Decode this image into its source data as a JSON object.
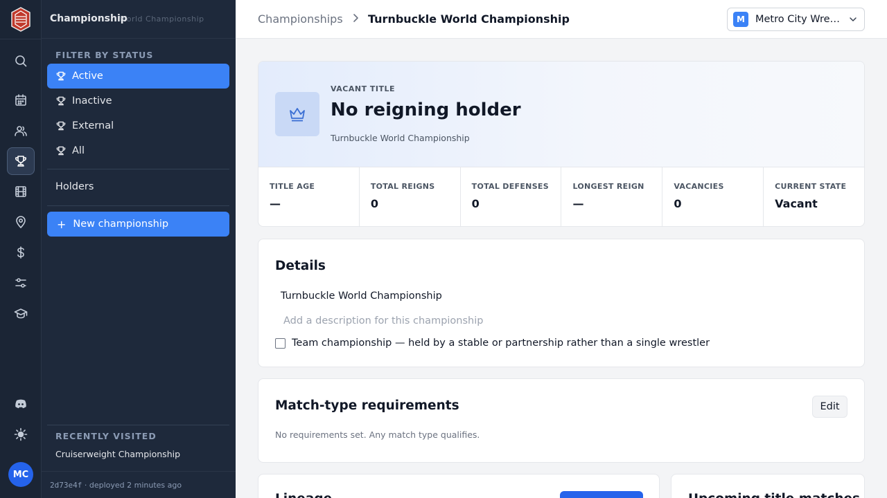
{
  "sidebar": {
    "title": "Championship",
    "title_ghost": "World Championship",
    "filter_label": "FILTER BY STATUS",
    "filters": [
      {
        "label": "Active",
        "active": true
      },
      {
        "label": "Inactive",
        "active": false
      },
      {
        "label": "External",
        "active": false
      },
      {
        "label": "All",
        "active": false
      }
    ],
    "holders_label": "Holders",
    "new_button": "New championship",
    "recent_label": "RECENTLY VISITED",
    "recent_items": [
      "Cruiserweight Championship"
    ],
    "footer_hash": "2d73e4f",
    "footer_deploy": " · deployed 2 minutes ago"
  },
  "rail": {
    "avatar_initials": "MC",
    "icons": [
      "search-icon",
      "calendar-icon",
      "users-icon",
      "trophy-icon",
      "film-icon",
      "map-pin-icon",
      "dollar-icon",
      "sliders-icon",
      "graduation-cap-icon",
      "discord-icon",
      "sun-icon"
    ],
    "active_icon": "trophy-icon"
  },
  "breadcrumb": {
    "root": "Championships",
    "current": "Turnbuckle World Championship"
  },
  "org": {
    "badge": "M",
    "name": "Metro City Wrestling"
  },
  "hero": {
    "kicker": "VACANT TITLE",
    "title": "No reigning holder",
    "subtitle": "Turnbuckle World Championship"
  },
  "stats": [
    {
      "label": "TITLE AGE",
      "value": "—"
    },
    {
      "label": "TOTAL REIGNS",
      "value": "0"
    },
    {
      "label": "TOTAL DEFENSES",
      "value": "0"
    },
    {
      "label": "LONGEST REIGN",
      "value": "—"
    },
    {
      "label": "VACANCIES",
      "value": "0"
    },
    {
      "label": "CURRENT STATE",
      "value": "Vacant"
    }
  ],
  "details": {
    "title": "Details",
    "name_value": "Turnbuckle World Championship",
    "description_placeholder": "Add a description for this championship",
    "team_label": "Team championship — held by a stable or partnership rather than a single wrestler"
  },
  "requirements": {
    "title": "Match-type requirements",
    "edit_label": "Edit",
    "note": "No requirements set. Any match type qualifies."
  },
  "lineage": {
    "title": "Lineage"
  },
  "upcoming": {
    "title": "Upcoming title matches"
  },
  "colors": {
    "accent": "#3b82f6",
    "sidebar_bg": "#1e293b",
    "rail_bg": "#1b2535"
  }
}
